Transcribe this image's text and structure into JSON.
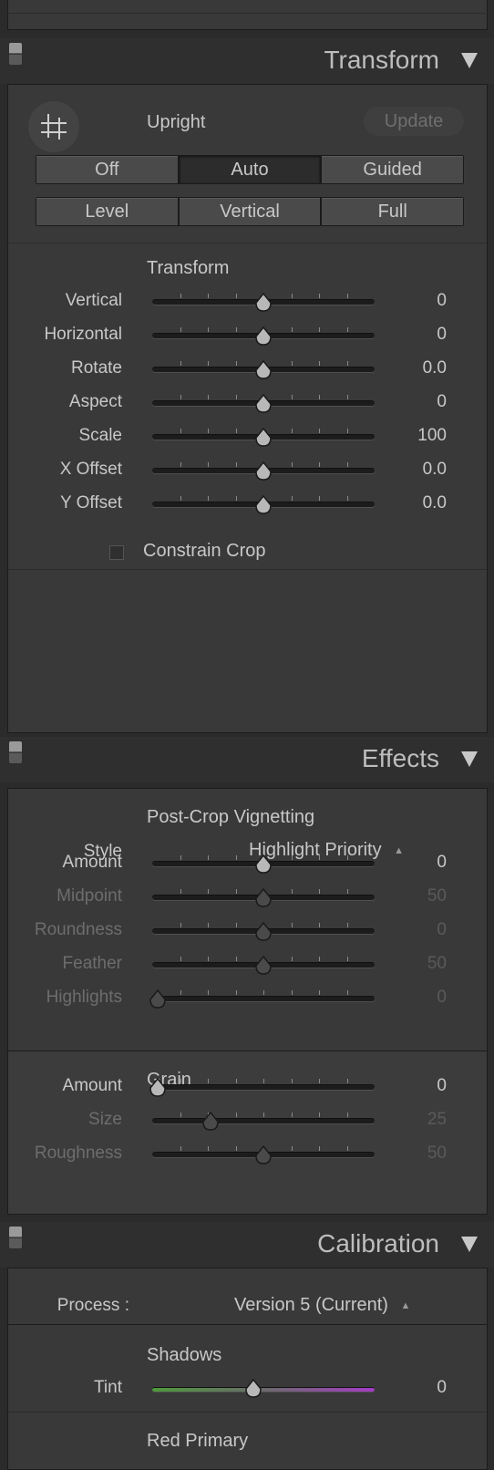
{
  "transform_panel": {
    "header_title": "Transform",
    "upright": {
      "label": "Upright",
      "update_button": "Update",
      "row1": [
        "Off",
        "Auto",
        "Guided"
      ],
      "row2": [
        "Level",
        "Vertical",
        "Full"
      ],
      "selected": "Auto"
    },
    "section_title": "Transform",
    "sliders": [
      {
        "label": "Vertical",
        "value": "0",
        "position": 0.5
      },
      {
        "label": "Horizontal",
        "value": "0",
        "position": 0.5
      },
      {
        "label": "Rotate",
        "value": "0.0",
        "position": 0.5
      },
      {
        "label": "Aspect",
        "value": "0",
        "position": 0.5
      },
      {
        "label": "Scale",
        "value": "100",
        "position": 0.5
      },
      {
        "label": "X Offset",
        "value": "0.0",
        "position": 0.5
      },
      {
        "label": "Y Offset",
        "value": "0.0",
        "position": 0.5
      }
    ],
    "constrain_crop": {
      "label": "Constrain Crop",
      "checked": false
    }
  },
  "effects_panel": {
    "header_title": "Effects",
    "vignette": {
      "section_title": "Post-Crop Vignetting",
      "style_label": "Style",
      "style_value": "Highlight Priority",
      "sliders": [
        {
          "label": "Amount",
          "value": "0",
          "position": 0.5,
          "enabled": true
        },
        {
          "label": "Midpoint",
          "value": "50",
          "position": 0.5,
          "enabled": false
        },
        {
          "label": "Roundness",
          "value": "0",
          "position": 0.5,
          "enabled": false
        },
        {
          "label": "Feather",
          "value": "50",
          "position": 0.5,
          "enabled": false
        },
        {
          "label": "Highlights",
          "value": "0",
          "position": 0.0,
          "enabled": false
        }
      ]
    },
    "grain": {
      "section_title": "Grain",
      "sliders": [
        {
          "label": "Amount",
          "value": "0",
          "position": 0.0,
          "enabled": true
        },
        {
          "label": "Size",
          "value": "25",
          "position": 0.25,
          "enabled": false
        },
        {
          "label": "Roughness",
          "value": "50",
          "position": 0.5,
          "enabled": false
        }
      ]
    }
  },
  "calibration_panel": {
    "header_title": "Calibration",
    "process_label": "Process :",
    "process_value": "Version 5 (Current)",
    "shadows_title": "Shadows",
    "tint": {
      "label": "Tint",
      "value": "0",
      "position": 0.5
    },
    "red_primary_title": "Red Primary"
  },
  "colors": {
    "tint_green": "#4e9a3c",
    "tint_magenta": "#a63cc6"
  }
}
